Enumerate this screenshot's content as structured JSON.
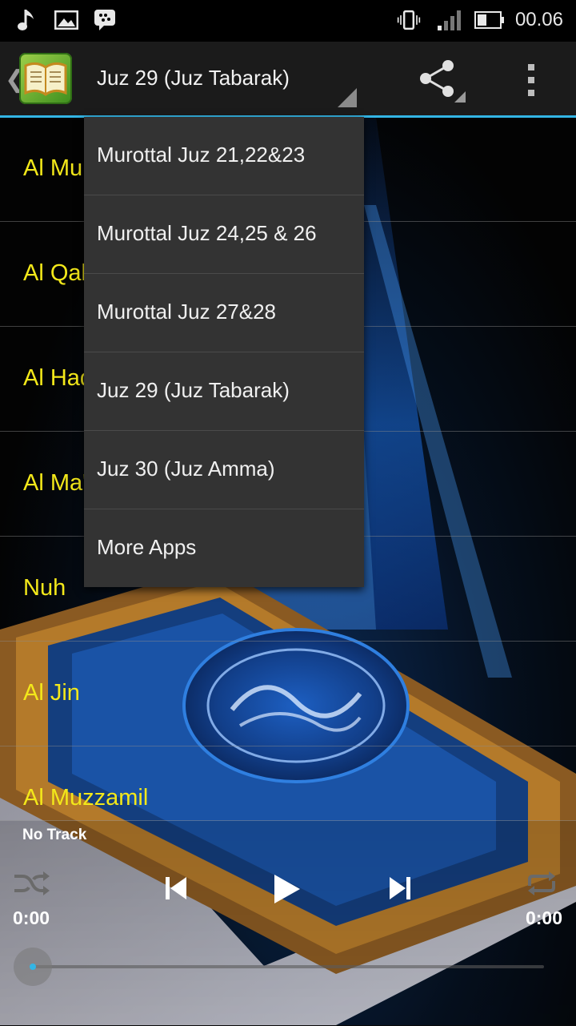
{
  "status_bar": {
    "time": "00.06",
    "icons": [
      "music-note-icon",
      "image-icon",
      "bbm-icon",
      "vibrate-icon",
      "signal-icon",
      "battery-icon"
    ]
  },
  "action_bar": {
    "app_icon": "quran-book-icon",
    "selected_juz": "Juz 29 (Juz Tabarak)",
    "share_icon": "share-icon",
    "overflow_icon": "overflow-menu-icon"
  },
  "surah_list": [
    {
      "name": "Al Mulk"
    },
    {
      "name": "Al Qalam"
    },
    {
      "name": "Al Haqqah"
    },
    {
      "name": "Al Ma'arij"
    },
    {
      "name": "Nuh"
    },
    {
      "name": "Al Jin"
    },
    {
      "name": "Al Muzzamil"
    }
  ],
  "dropdown": {
    "items": [
      {
        "label": "Murottal Juz 21,22&23"
      },
      {
        "label": "Murottal Juz 24,25 & 26"
      },
      {
        "label": "Murottal Juz 27&28"
      },
      {
        "label": "Juz 29 (Juz Tabarak)"
      },
      {
        "label": "Juz 30 (Juz Amma)"
      },
      {
        "label": "More Apps"
      }
    ]
  },
  "player": {
    "track": "No Track",
    "elapsed": "0:00",
    "duration": "0:00",
    "progress": 0,
    "accent_color": "#33b5e5"
  },
  "colors": {
    "list_text": "#f3e81a",
    "menu_bg": "#333333",
    "action_bar_accent": "#33b5e5"
  }
}
